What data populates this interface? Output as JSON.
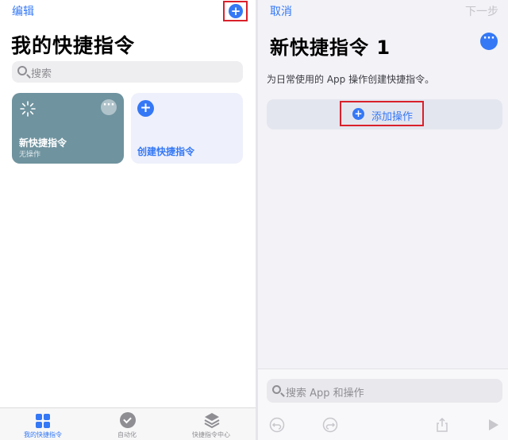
{
  "left": {
    "header": {
      "edit_label": "编辑",
      "add_icon": "plus-circle-icon"
    },
    "title": "我的快捷指令",
    "search": {
      "placeholder": "搜索"
    },
    "cards": [
      {
        "name": "新快捷指令",
        "subtitle": "无操作",
        "icon": "sparkle-icon",
        "color": "#6f939f"
      },
      {
        "name": "创建快捷指令",
        "icon": "plus-circle-icon",
        "color": "#eef0fb"
      }
    ],
    "tabs": [
      {
        "label": "我的快捷指令",
        "icon": "grid-icon",
        "active": true
      },
      {
        "label": "自动化",
        "icon": "clock-check-icon",
        "active": false
      },
      {
        "label": "快捷指令中心",
        "icon": "layers-icon",
        "active": false
      }
    ]
  },
  "right": {
    "header": {
      "cancel_label": "取消",
      "next_label": "下一步"
    },
    "title": "新快捷指令 1",
    "description": "为日常使用的 App 操作创建快捷指令。",
    "add_action_label": "添加操作",
    "search": {
      "placeholder": "搜索 App 和操作"
    },
    "toolbar": [
      "undo-icon",
      "redo-icon",
      "share-icon",
      "play-icon"
    ]
  },
  "colors": {
    "accent": "#3478f6",
    "highlight_border": "#d9202a",
    "card_bg": "#6f939f"
  }
}
